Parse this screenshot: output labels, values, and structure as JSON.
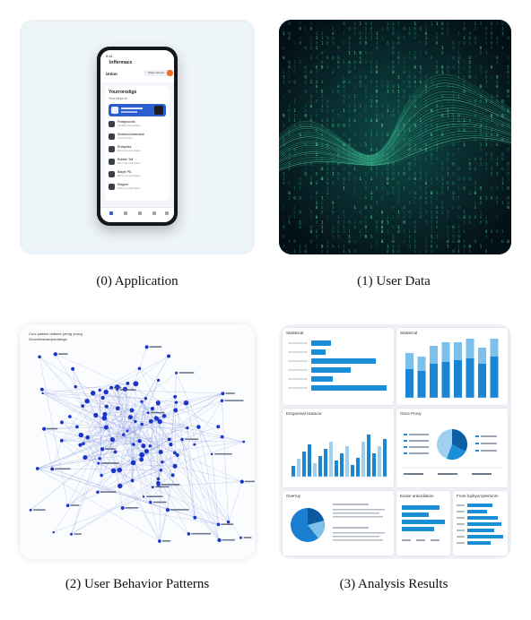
{
  "captions": [
    "(0) Application",
    "(1) User Data",
    "(2) User Behavior Patterns",
    "(3) Analysis Results"
  ],
  "app_screen": {
    "time": "9:41",
    "app_name": "Inffermacs",
    "tab": "Union",
    "top_button": "Share Screen",
    "card_title": "Yourrorodigs",
    "card_sub": "Your steps on",
    "rows": [
      {
        "title": "Featgrounds",
        "sub": "Cardgitle con retreatse"
      },
      {
        "title": "Shadesnnnsenstne",
        "sub": "Lets reccourse"
      },
      {
        "title": "Rrctspitss",
        "sub": "Mimo mee eets rrigens"
      },
      {
        "title": "Botdde Tell",
        "sub": "Mimo mee eets rrigens"
      },
      {
        "title": "Batyle PIL",
        "sub": "Mimo mee eets rrigens"
      },
      {
        "title": "Reigme",
        "sub": "Dooo mee eets rrigens"
      }
    ]
  },
  "network": {
    "legend": [
      "Cure pattern oldeere yrrorg yrrorg",
      "Grocsforstraroperaferge"
    ]
  },
  "dashboard": {
    "card_titles": [
      "Statistical",
      "Statistical",
      "Enrgonmal Hasacor",
      "Once Prooy",
      "Overruy",
      "Exase arderdiation",
      "From fupbyorcplertonm"
    ]
  },
  "colors": {
    "accent": "#1a7fd0",
    "data_green": "#35e08a",
    "node_blue": "#1a33c8"
  }
}
